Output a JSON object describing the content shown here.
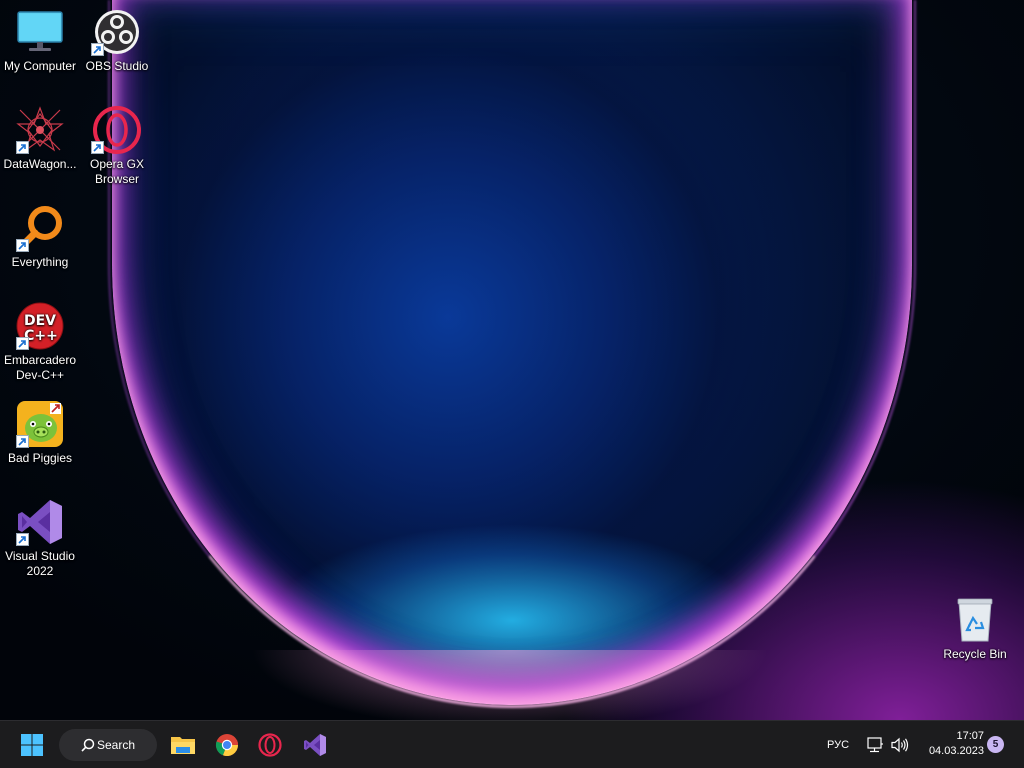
{
  "desktop": {
    "icons": [
      {
        "label": "My Computer",
        "icon": "monitor-icon"
      },
      {
        "label": "OBS Studio",
        "icon": "obs-studio-icon"
      },
      {
        "label": "DataWagon...",
        "icon": "datawagon-icon"
      },
      {
        "label": "Opera GX Browser",
        "icon": "opera-gx-icon"
      },
      {
        "label": "Everything",
        "icon": "everything-search-icon"
      },
      {
        "label": "Embarcadero Dev-C++",
        "icon": "devcpp-icon"
      },
      {
        "label": "Bad Piggies",
        "icon": "bad-piggies-icon"
      },
      {
        "label": "Visual Studio 2022",
        "icon": "visual-studio-icon"
      },
      {
        "label": "Recycle Bin",
        "icon": "recycle-bin-icon"
      }
    ],
    "devcpp_logo_text_top": "DEV",
    "devcpp_logo_text_bottom": "C++"
  },
  "taskbar": {
    "search_label": "Search",
    "pinned": [
      "windows-start-icon",
      "file-explorer-icon",
      "chrome-icon",
      "opera-gx-icon",
      "visual-studio-icon"
    ],
    "language": "РУС",
    "time": "17:07",
    "date": "04.03.2023",
    "notification_count": "5"
  },
  "colors": {
    "taskbar_bg": "#1c1c1e",
    "accent_orb_rim": "#ff9ee8",
    "wallpaper_purple": "#a52ec8",
    "wallpaper_blue": "#0a3ca0"
  }
}
